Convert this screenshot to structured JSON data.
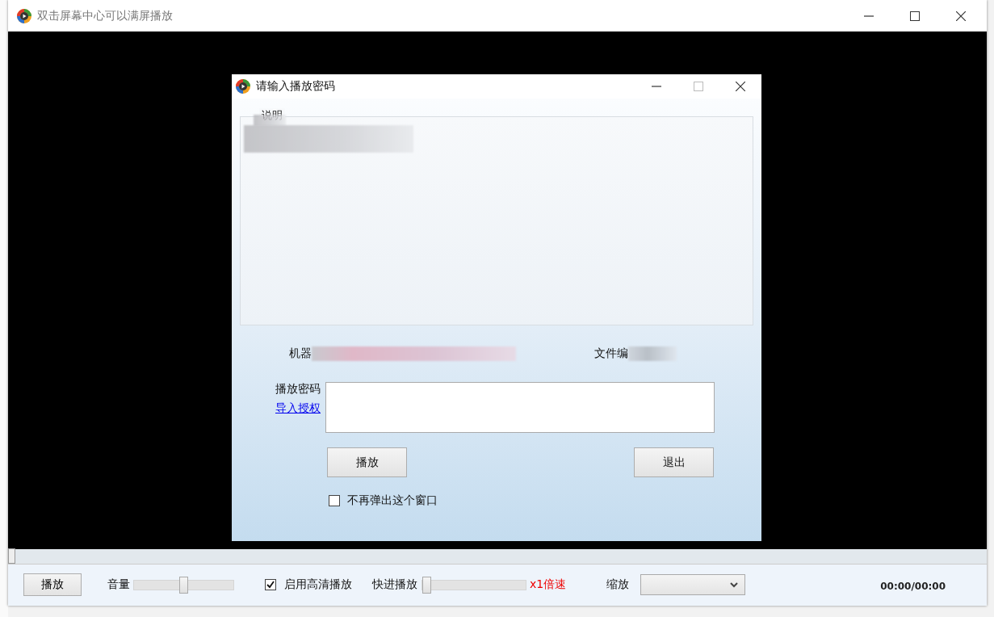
{
  "window": {
    "title": "双击屏幕中心可以满屏播放"
  },
  "dialog": {
    "title": "请输入播放密码",
    "group_label": "说明",
    "machine_code_label": "机器",
    "file_number_label": "文件编",
    "password_label": "播放密码",
    "import_link": "导入授权",
    "buttons": [
      "播放",
      "退出"
    ],
    "dont_show_again": {
      "label": "不再弹出这个窗口",
      "checked": false
    }
  },
  "controls": {
    "seek": {
      "level": 0
    },
    "play_button": "播放",
    "volume": {
      "label": "音量",
      "level": 0.5
    },
    "hd": {
      "label": "启用高清播放",
      "checked": true
    },
    "fast_forward": {
      "label": "快进播放",
      "level": 0,
      "reading": "x1倍速"
    },
    "zoom": {
      "label": "缩放"
    },
    "time": "00:00/00:00"
  }
}
